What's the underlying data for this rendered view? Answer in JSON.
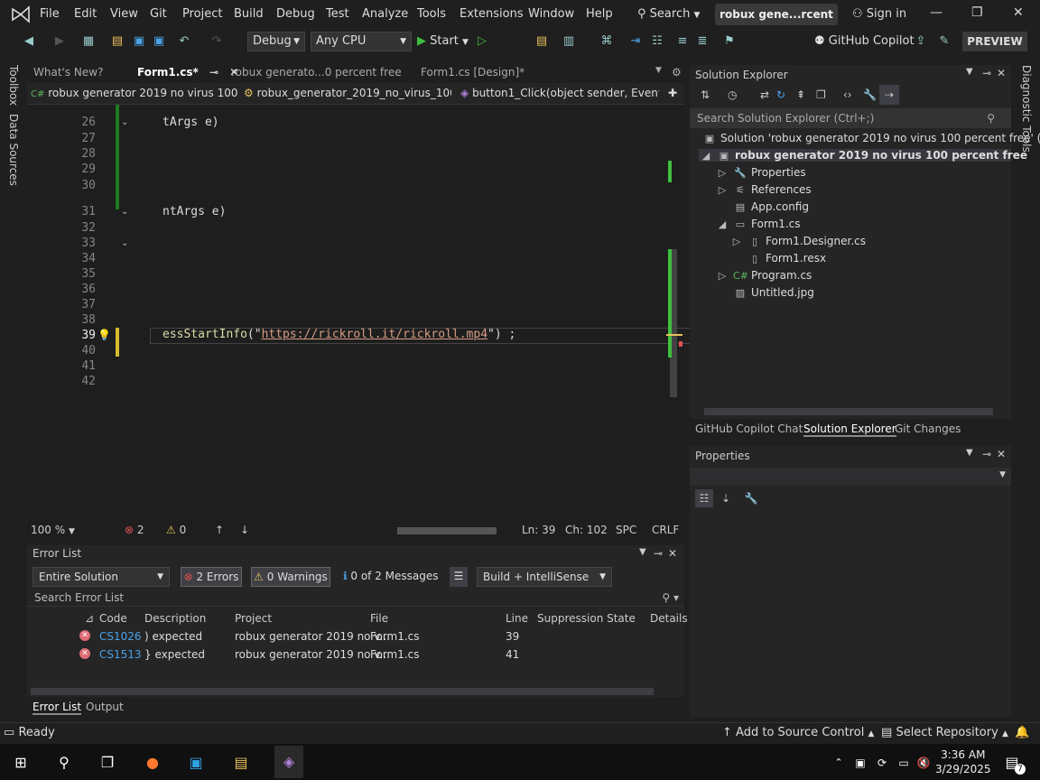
{
  "menubar": {
    "items": [
      "File",
      "Edit",
      "View",
      "Git",
      "Project",
      "Build",
      "Debug",
      "Test",
      "Analyze",
      "Tools",
      "Extensions",
      "Window",
      "Help"
    ],
    "search": "Search",
    "solution_title": "robux gene...rcent free",
    "sign_in": "Sign in"
  },
  "toolbar": {
    "config": "Debug",
    "platform": "Any CPU",
    "start": "Start",
    "copilot": "GitHub Copilot",
    "preview": "PREVIEW"
  },
  "left_strip": {
    "toolbox": "Toolbox",
    "data_sources": "Data Sources"
  },
  "right_strip": {
    "diagnostic": "Diagnostic Tools"
  },
  "doc_tabs": [
    {
      "label": "What's New?"
    },
    {
      "label": "Form1.cs*"
    },
    {
      "label": "robux generato...0 percent free"
    },
    {
      "label": "Form1.cs [Design]*"
    }
  ],
  "nav_bar": {
    "project": "robux generator 2019 no virus 100 per",
    "class": "robux_generator_2019_no_virus_100_p",
    "member": "button1_Click(object sender, EventAr"
  },
  "editor": {
    "lines": [
      {
        "n": "26",
        "code": "tArgs e)"
      },
      {
        "n": "27",
        "code": ""
      },
      {
        "n": "28",
        "code": ""
      },
      {
        "n": "29",
        "code": ""
      },
      {
        "n": "30",
        "code": ""
      },
      {
        "n": "31",
        "code": "ntArgs e)"
      },
      {
        "n": "32",
        "code": ""
      },
      {
        "n": "33",
        "code": ""
      },
      {
        "n": "34",
        "code": ""
      },
      {
        "n": "35",
        "code": ""
      },
      {
        "n": "36",
        "code": ""
      },
      {
        "n": "37",
        "code": ""
      },
      {
        "n": "38",
        "code": ""
      },
      {
        "n": "39",
        "code_prefix": "essStartInfo",
        "code_paren": "(\"",
        "code_url": "https://rickroll.it/rickroll.mp4",
        "code_suffix": "\") ;"
      },
      {
        "n": "40",
        "code": ""
      },
      {
        "n": "41",
        "code": ""
      },
      {
        "n": "42",
        "code": ""
      }
    ]
  },
  "editor_status": {
    "zoom": "100 %",
    "errors": "2",
    "warnings": "0",
    "line": "Ln: 39",
    "col": "Ch: 102",
    "spc": "SPC",
    "eol": "CRLF"
  },
  "error_list": {
    "title": "Error List",
    "scope": "Entire Solution",
    "errors_btn": "2 Errors",
    "warnings_btn": "0 Warnings",
    "messages_btn": "0 of 2 Messages",
    "build": "Build + IntelliSense",
    "search": "Search Error List",
    "columns": [
      "Code",
      "Description",
      "Project",
      "File",
      "Line",
      "Suppression State",
      "Details"
    ],
    "rows": [
      {
        "code": "CS1026",
        "desc": ") expected",
        "project": "robux generator 2019 no v...",
        "file": "Form1.cs",
        "line": "39"
      },
      {
        "code": "CS1513",
        "desc": "} expected",
        "project": "robux generator 2019 no v...",
        "file": "Form1.cs",
        "line": "41"
      }
    ],
    "tabs": [
      "Error List",
      "Output"
    ]
  },
  "solution_explorer": {
    "title": "Solution Explorer",
    "search": "Search Solution Explorer (Ctrl+;)",
    "items": [
      {
        "label": "Solution 'robux generator 2019 no virus 100 percent free' (1 o",
        "icon": "solution-icon"
      },
      {
        "label": "robux generator 2019 no virus 100 percent free",
        "icon": "csproj-icon"
      },
      {
        "label": "Properties",
        "icon": "wrench-icon"
      },
      {
        "label": "References",
        "icon": "references-icon"
      },
      {
        "label": "App.config",
        "icon": "config-icon"
      },
      {
        "label": "Form1.cs",
        "icon": "form-icon"
      },
      {
        "label": "Form1.Designer.cs",
        "icon": "file-icon"
      },
      {
        "label": "Form1.resx",
        "icon": "file-icon"
      },
      {
        "label": "Program.cs",
        "icon": "csharp-icon"
      },
      {
        "label": "Untitled.jpg",
        "icon": "image-icon"
      }
    ],
    "tabs": [
      "GitHub Copilot Chat",
      "Solution Explorer",
      "Git Changes"
    ]
  },
  "properties": {
    "title": "Properties"
  },
  "statusbar": {
    "ready": "Ready",
    "source_control": "Add to Source Control",
    "repo": "Select Repository"
  },
  "taskbar": {
    "time": "3:36 AM",
    "date": "3/29/2025",
    "notif": "7"
  }
}
